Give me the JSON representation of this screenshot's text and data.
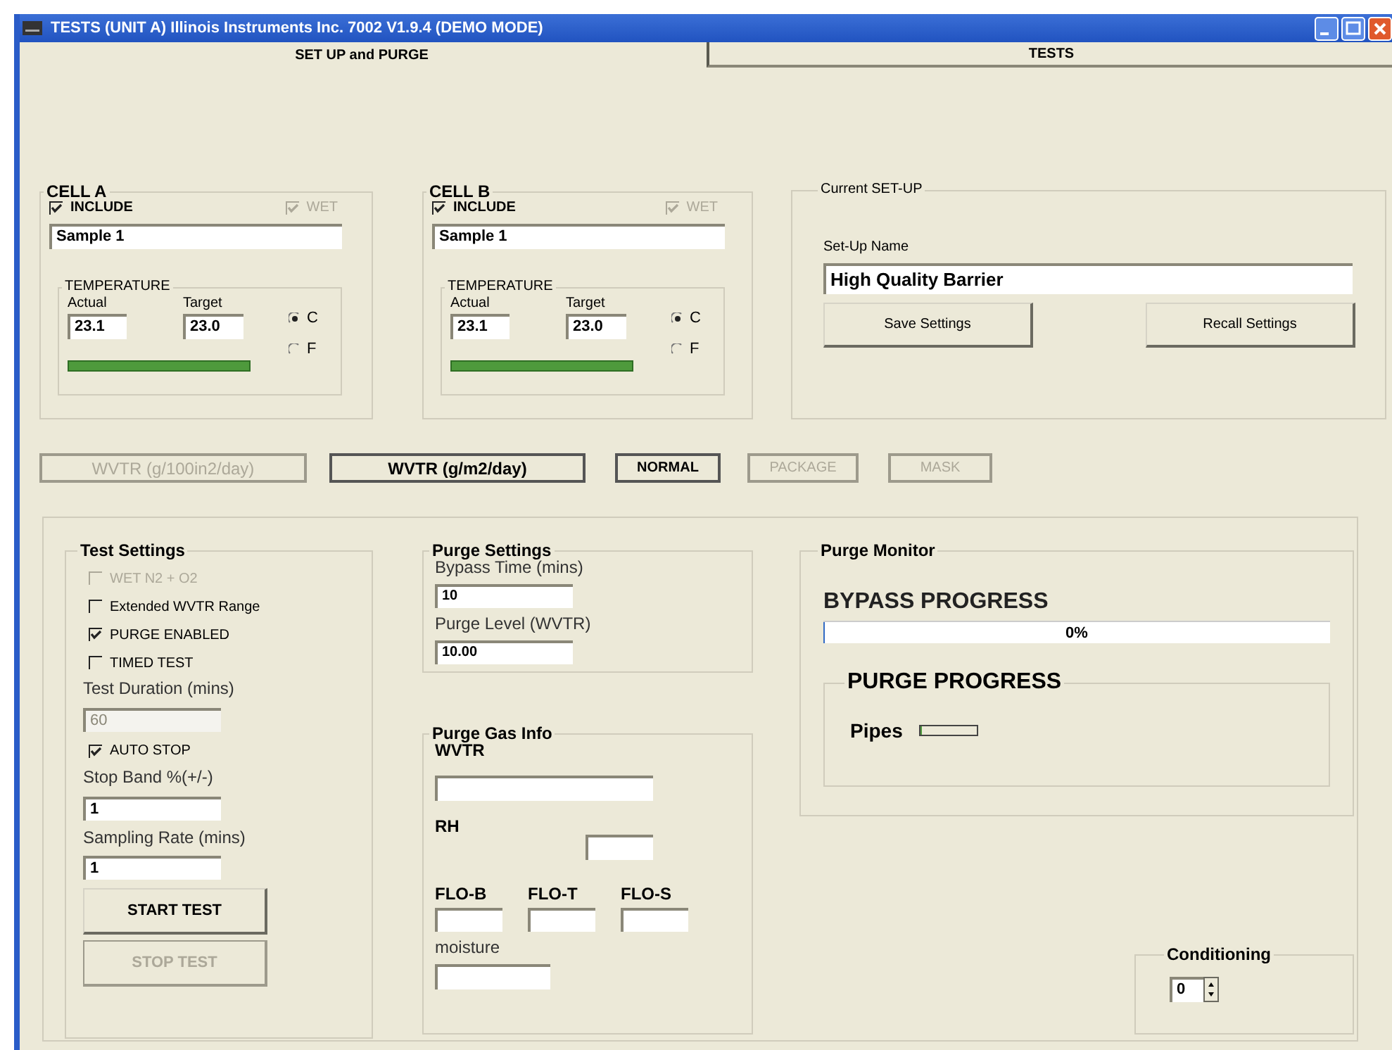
{
  "window": {
    "title": "TESTS (UNIT A) Illinois Instruments Inc. 7002 V1.9.4 (DEMO MODE)"
  },
  "tabs": [
    {
      "label": "SET UP and PURGE",
      "selected": true
    },
    {
      "label": "TESTS",
      "selected": false
    }
  ],
  "cells": [
    {
      "title": "CELL A",
      "include": {
        "label": "INCLUDE",
        "checked": true
      },
      "wet": {
        "label": "WET",
        "checked": true,
        "disabled": true
      },
      "sample": "Sample 1",
      "temperature": {
        "title": "TEMPERATURE",
        "actual_label": "Actual",
        "actual": "23.1",
        "target_label": "Target",
        "target": "23.0",
        "units": [
          {
            "label": "C",
            "selected": true
          },
          {
            "label": "F",
            "selected": false
          }
        ],
        "level": 1
      }
    },
    {
      "title": "CELL B",
      "include": {
        "label": "INCLUDE",
        "checked": true
      },
      "wet": {
        "label": "WET",
        "checked": true,
        "disabled": true
      },
      "sample": "Sample 1",
      "temperature": {
        "title": "TEMPERATURE",
        "actual_label": "Actual",
        "actual": "23.1",
        "target_label": "Target",
        "target": "23.0",
        "units": [
          {
            "label": "C",
            "selected": true
          },
          {
            "label": "F",
            "selected": false
          }
        ],
        "level": 1
      }
    }
  ],
  "current_setup": {
    "title": "Current SET-UP",
    "name_label": "Set-Up Name",
    "name": "High Quality Barrier",
    "buttons": [
      "Save Settings",
      "Recall Settings"
    ]
  },
  "mode_buttons": [
    {
      "label": "WVTR (g/100in2/day)",
      "disabled": true
    },
    {
      "label": "WVTR (g/m2/day)",
      "disabled": false
    },
    {
      "label": "NORMAL",
      "disabled": false
    },
    {
      "label": "PACKAGE",
      "disabled": true
    },
    {
      "label": "MASK",
      "disabled": true
    }
  ],
  "test_settings": {
    "title": "Test Settings",
    "items": [
      {
        "kind": "check",
        "label": "WET N2 + O2",
        "checked": false,
        "disabled": true
      },
      {
        "kind": "check",
        "label": "Extended WVTR Range",
        "checked": false,
        "disabled": false
      },
      {
        "kind": "check",
        "label": "PURGE ENABLED",
        "checked": true,
        "disabled": false
      },
      {
        "kind": "check",
        "label": "TIMED TEST",
        "checked": false,
        "disabled": false
      },
      {
        "kind": "field",
        "label": "Test Duration (mins)",
        "value": "60",
        "disabled": true
      },
      {
        "kind": "check",
        "label": "AUTO STOP",
        "checked": true,
        "disabled": false
      },
      {
        "kind": "field",
        "label": "Stop Band %(+/-)",
        "value": "1",
        "disabled": false
      },
      {
        "kind": "field",
        "label": "Sampling Rate (mins)",
        "value": "1",
        "disabled": false
      }
    ],
    "buttons": [
      {
        "label": "START TEST",
        "disabled": false
      },
      {
        "label": "STOP TEST",
        "disabled": true
      }
    ]
  },
  "purge_settings": {
    "title": "Purge Settings",
    "fields": [
      {
        "label": "Bypass Time (mins)",
        "value": "10"
      },
      {
        "label": "Purge Level (WVTR)",
        "value": "10.00"
      }
    ]
  },
  "purge_gas_info": {
    "title": "Purge Gas Info",
    "wvtr_label": "WVTR",
    "rh_label": "RH",
    "flows": [
      "FLO-B",
      "FLO-T",
      "FLO-S"
    ],
    "moisture_label": "moisture"
  },
  "purge_monitor": {
    "title": "Purge Monitor",
    "bypass_label": "BYPASS PROGRESS",
    "bypass": {
      "level": 0,
      "reading": "0%"
    },
    "purge_title": "PURGE PROGRESS",
    "pipes_label": "Pipes",
    "pipes": {
      "level": 0
    }
  },
  "conditioning": {
    "title": "Conditioning",
    "value": "0"
  }
}
